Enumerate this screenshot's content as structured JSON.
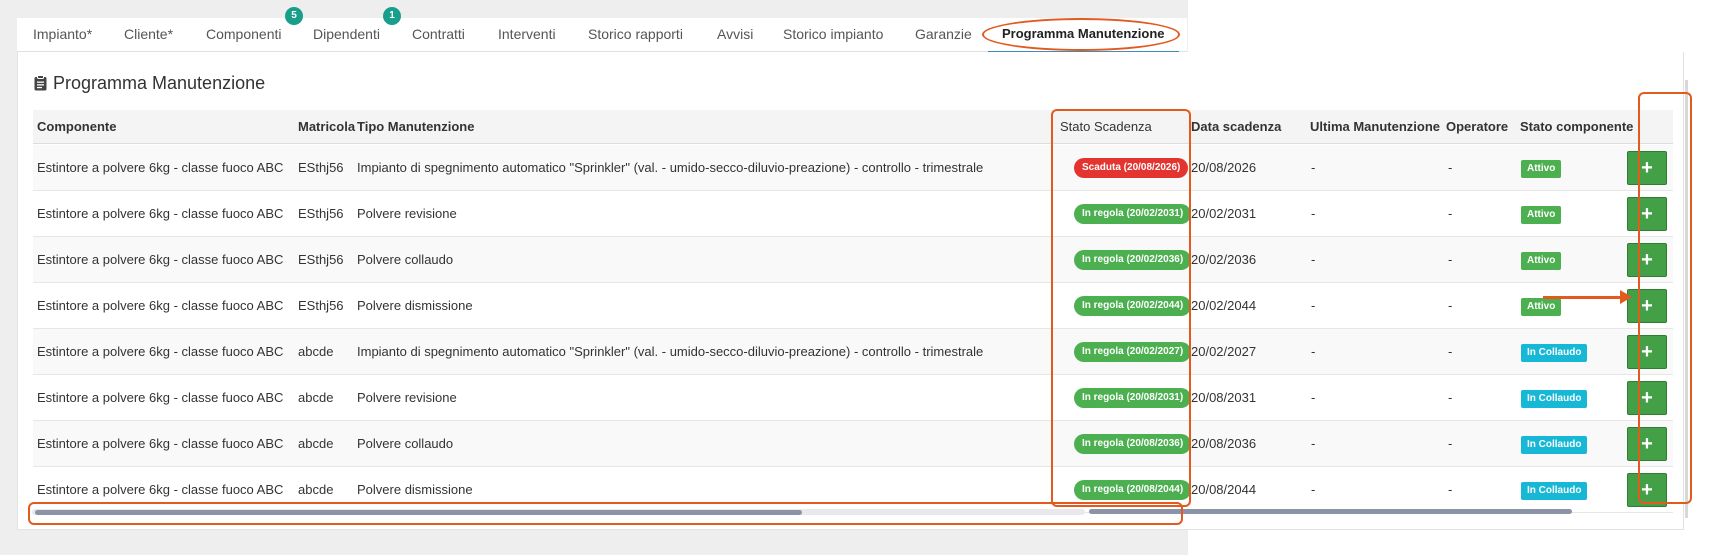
{
  "tabs": [
    {
      "label": "Impianto*"
    },
    {
      "label": "Cliente*"
    },
    {
      "label": "Componenti",
      "badge": "5"
    },
    {
      "label": "Dipendenti",
      "badge": "1"
    },
    {
      "label": "Contratti"
    },
    {
      "label": "Interventi"
    },
    {
      "label": "Storico rapporti"
    },
    {
      "label": "Avvisi"
    },
    {
      "label": "Storico impianto"
    },
    {
      "label": "Garanzie"
    },
    {
      "label": "Programma Manutenzione",
      "active": true
    }
  ],
  "card": {
    "title": "Programma Manutenzione",
    "icon": "clipboard-icon"
  },
  "table": {
    "headers": [
      "Componente",
      "Matricola",
      "Tipo Manutenzione",
      "Stato Scadenza",
      "Data scadenza",
      "Ultima Manutenzione",
      "Operatore",
      "Stato componente"
    ],
    "add_label": "+",
    "rows": [
      {
        "componente": "Estintore a polvere 6kg - classe fuoco ABC",
        "matricola": "ESthj56",
        "tipo": "Impianto di spegnimento automatico \"Sprinkler\" (val. - umido-secco-diluvio-preazione) - controllo - trimestrale",
        "stato_scadenza": "Scaduta (20/08/2026)",
        "scadenza_status": "red",
        "data_scadenza": "20/08/2026",
        "ultima": "-",
        "operatore": "-",
        "stato_componente": "Attivo",
        "componente_status": "green"
      },
      {
        "componente": "Estintore a polvere 6kg - classe fuoco ABC",
        "matricola": "ESthj56",
        "tipo": "Polvere revisione",
        "stato_scadenza": "In regola (20/02/2031)",
        "scadenza_status": "green",
        "data_scadenza": "20/02/2031",
        "ultima": "-",
        "operatore": "-",
        "stato_componente": "Attivo",
        "componente_status": "green"
      },
      {
        "componente": "Estintore a polvere 6kg - classe fuoco ABC",
        "matricola": "ESthj56",
        "tipo": "Polvere collaudo",
        "stato_scadenza": "In regola (20/02/2036)",
        "scadenza_status": "green",
        "data_scadenza": "20/02/2036",
        "ultima": "-",
        "operatore": "-",
        "stato_componente": "Attivo",
        "componente_status": "green"
      },
      {
        "componente": "Estintore a polvere 6kg - classe fuoco ABC",
        "matricola": "ESthj56",
        "tipo": "Polvere dismissione",
        "stato_scadenza": "In regola (20/02/2044)",
        "scadenza_status": "green",
        "data_scadenza": "20/02/2044",
        "ultima": "-",
        "operatore": "-",
        "stato_componente": "Attivo",
        "componente_status": "green"
      },
      {
        "componente": "Estintore a polvere 6kg - classe fuoco ABC",
        "matricola": "abcde",
        "tipo": "Impianto di spegnimento automatico \"Sprinkler\" (val. - umido-secco-diluvio-preazione) - controllo - trimestrale",
        "stato_scadenza": "In regola (20/02/2027)",
        "scadenza_status": "green",
        "data_scadenza": "20/02/2027",
        "ultima": "-",
        "operatore": "-",
        "stato_componente": "In Collaudo",
        "componente_status": "cyan"
      },
      {
        "componente": "Estintore a polvere 6kg - classe fuoco ABC",
        "matricola": "abcde",
        "tipo": "Polvere revisione",
        "stato_scadenza": "In regola (20/08/2031)",
        "scadenza_status": "green",
        "data_scadenza": "20/08/2031",
        "ultima": "-",
        "operatore": "-",
        "stato_componente": "In Collaudo",
        "componente_status": "cyan"
      },
      {
        "componente": "Estintore a polvere 6kg - classe fuoco ABC",
        "matricola": "abcde",
        "tipo": "Polvere collaudo",
        "stato_scadenza": "In regola (20/08/2036)",
        "scadenza_status": "green",
        "data_scadenza": "20/08/2036",
        "ultima": "-",
        "operatore": "-",
        "stato_componente": "In Collaudo",
        "componente_status": "cyan"
      },
      {
        "componente": "Estintore a polvere 6kg - classe fuoco ABC",
        "matricola": "abcde",
        "tipo": "Polvere dismissione",
        "stato_scadenza": "In regola (20/08/2044)",
        "scadenza_status": "green",
        "data_scadenza": "20/08/2044",
        "ultima": "-",
        "operatore": "-",
        "stato_componente": "In Collaudo",
        "componente_status": "cyan"
      }
    ]
  },
  "scrollbar": {
    "position_fraction": 0.0,
    "visible_fraction": 0.73
  },
  "colors": {
    "accent": "#3c8dbc",
    "badge": "#1a9e8c",
    "expired": "#e3342f",
    "ok": "#4caf50",
    "collaudo": "#17b7d6",
    "annotation": "#e35a1e"
  }
}
